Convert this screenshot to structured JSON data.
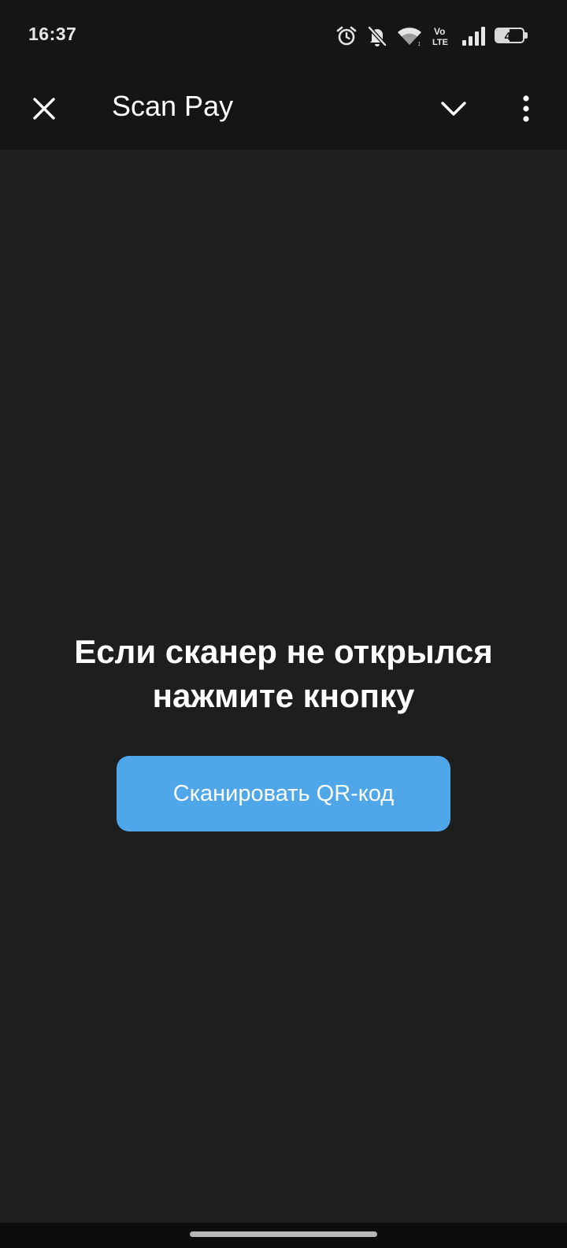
{
  "status_bar": {
    "time": "16:37",
    "icons": [
      "alarm-icon",
      "bell-off-icon",
      "wifi-icon",
      "volte-icon",
      "signal-icon",
      "battery-icon"
    ],
    "volte_label_top": "Vo",
    "volte_label_bottom": "LTE",
    "battery_level": "49",
    "battery_fraction": 0.49
  },
  "app_bar": {
    "title": "Scan Pay",
    "icons": [
      "close-icon",
      "chevron-down-icon",
      "more-vertical-icon"
    ]
  },
  "main": {
    "message_line_1": "Если сканер не открылся",
    "message_line_2": "нажмите кнопку",
    "scan_button_label": "Сканировать QR-код"
  },
  "colors": {
    "background": "#1e1e1e",
    "bars": "#151515",
    "accent_button": "#4fa6e8",
    "text": "#ffffff"
  }
}
